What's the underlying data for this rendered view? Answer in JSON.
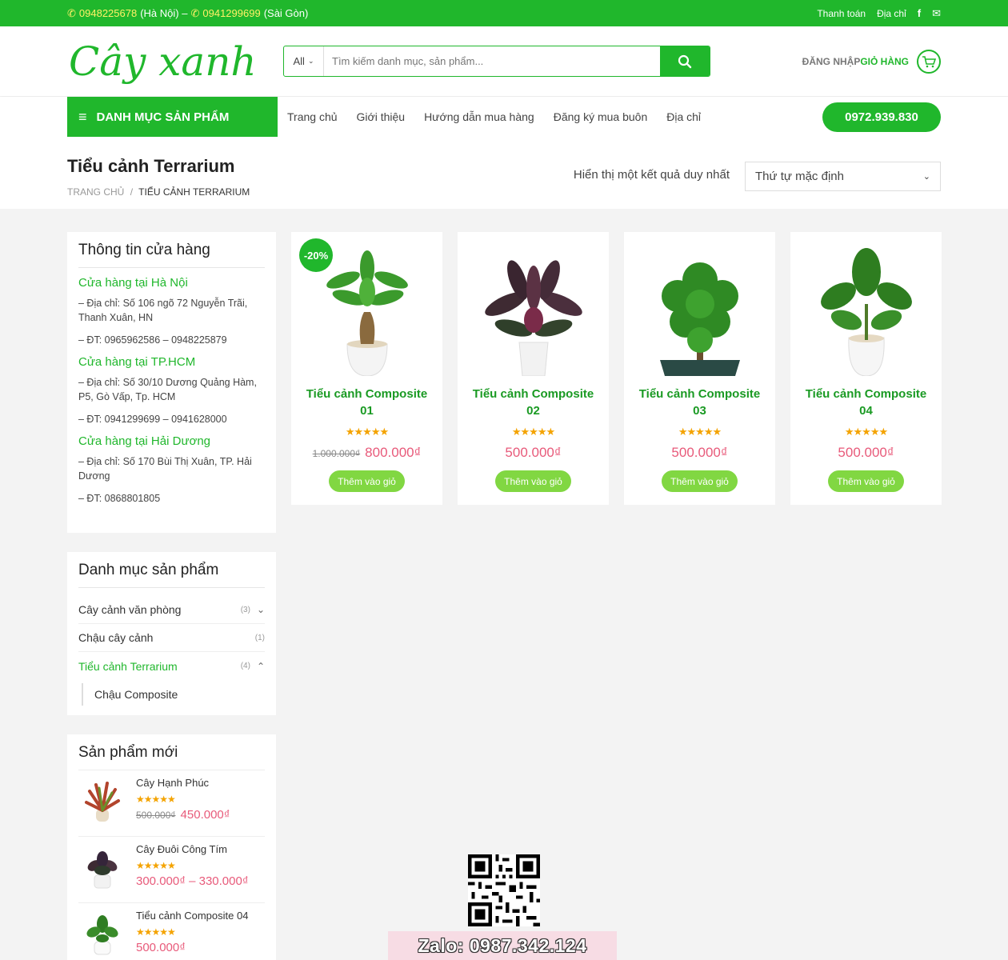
{
  "topbar": {
    "phone1": "0948225678",
    "loc1": "(Hà Nội) –",
    "phone2": "0941299699",
    "loc2": "(Sài Gòn)",
    "links": [
      "Thanh toán",
      "Địa chỉ"
    ],
    "icons": [
      "facebook-icon",
      "envelope-icon"
    ]
  },
  "header": {
    "logo_text": "Cây xanh",
    "search": {
      "category": "All",
      "placeholder": "Tìm kiếm danh mục, sản phẩm..."
    },
    "login_label": "ĐĂNG NHẬP",
    "cart_label": "GIỎ HÀNG"
  },
  "nav": {
    "category_label": "DANH MỤC SẢN PHẨM",
    "links": [
      "Trang chủ",
      "Giới thiệu",
      "Hướng dẫn mua hàng",
      "Đăng ký mua buôn",
      "Địa chỉ"
    ],
    "hotline": "0972.939.830"
  },
  "page": {
    "title": "Tiểu cảnh Terrarium",
    "breadcrumb": [
      "TRANG CHỦ",
      "/",
      "TIỂU CẢNH TERRARIUM"
    ],
    "result_text": "Hiển thị một kết quả duy nhất",
    "order_select": "Thứ tự mặc định"
  },
  "store_info": {
    "title": "Thông tin cửa hàng",
    "stores": [
      {
        "name": "Cửa hàng tại Hà Nội",
        "address": "– Địa chỉ: Số 106 ngõ 72 Nguyễn Trãi, Thanh Xuân, HN",
        "phone": "– ĐT: 0965962586 – 0948225879"
      },
      {
        "name": "Cửa hàng tại TP.HCM",
        "address": "– Địa chỉ: Số 30/10 Dương Quảng Hàm, P5, Gò Vấp, Tp. HCM",
        "phone": "– ĐT: 0941299699 – 0941628000"
      },
      {
        "name": "Cửa hàng tại Hải Dương",
        "address": "– Địa chỉ: Số 170 Bùi Thị Xuân, TP. Hải Dương",
        "phone": "– ĐT: 0868801805"
      }
    ]
  },
  "categories": {
    "title": "Danh mục sản phẩm",
    "items": [
      {
        "label": "Cây cảnh văn phòng",
        "count": "(3)"
      },
      {
        "label": "Chậu cây cảnh",
        "count": "(1)"
      },
      {
        "label": "Tiểu cảnh Terrarium",
        "count": "(4)"
      }
    ],
    "sub": "Chậu Composite"
  },
  "new_products": {
    "title": "Sản phẩm mới",
    "items": [
      {
        "name": "Cây Hạnh Phúc",
        "old": "500.000₫",
        "price": "450.000₫",
        "rating": 5
      },
      {
        "name": "Cây Đuôi Công Tím",
        "old": "",
        "price": "300.000₫ – 330.000₫",
        "rating": 5
      },
      {
        "name": "Tiểu cảnh Composite 04",
        "old": "",
        "price": "500.000₫",
        "rating": 5
      }
    ]
  },
  "products": [
    {
      "name": "Tiểu cảnh Composite 01",
      "badge": "-20%",
      "old": "1.000.000₫",
      "price": "800.000₫",
      "button": "Thêm vào giỏ",
      "rating": 5
    },
    {
      "name": "Tiểu cảnh Composite 02",
      "badge": "",
      "old": "",
      "price": "500.000₫",
      "button": "Thêm vào giỏ",
      "rating": 5
    },
    {
      "name": "Tiểu cảnh Composite 03",
      "badge": "",
      "old": "",
      "price": "500.000₫",
      "button": "Thêm vào giỏ",
      "rating": 5
    },
    {
      "name": "Tiểu cảnh Composite 04",
      "badge": "",
      "old": "",
      "price": "500.000₫",
      "button": "Thêm vào giỏ",
      "rating": 5
    }
  ],
  "stars_glyph": "★★★★★",
  "zalo": "Zalo: 0987.342.124",
  "colors": {
    "brand": "#20b72c",
    "price": "#e85a7a",
    "button": "#81d742",
    "star": "#f4a300"
  }
}
